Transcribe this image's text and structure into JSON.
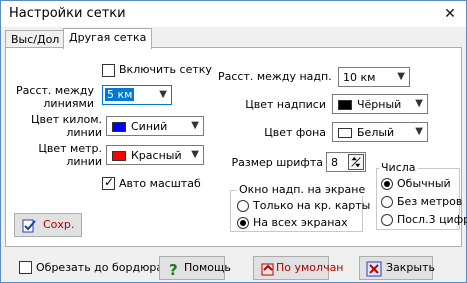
{
  "window": {
    "title": "Настройки сетки",
    "close_glyph": "✕"
  },
  "tabs": [
    {
      "label": "Выс/Дол",
      "active": false
    },
    {
      "label": "Другая сетка",
      "active": true
    }
  ],
  "left": {
    "enable_grid_label": "Включить сетку",
    "enable_grid_checked": false,
    "distance_label": "Расст. между\nлиниями",
    "distance_value": "5 км",
    "km_color_label": "Цвет килом.\nлинии",
    "km_color_value": "Синий",
    "km_color_hex": "#0000ff",
    "m_color_label": "Цвет метр.\nлинии",
    "m_color_value": "Красный",
    "m_color_hex": "#ff0000",
    "auto_scale_label": "Авто масштаб",
    "auto_scale_checked": true,
    "save_button": "Сохр."
  },
  "right": {
    "label_distance_label": "Расст. между надп.",
    "label_distance_value": "10 км",
    "label_color_label": "Цвет надписи",
    "label_color_value": "Чёрный",
    "label_color_hex": "#000000",
    "bg_color_label": "Цвет фона",
    "bg_color_value": "Белый",
    "bg_color_hex": "#ffffff",
    "font_size_label": "Размер шрифта",
    "font_size_value": "8",
    "window_group": {
      "title": "Окно надп. на экране",
      "options": [
        "Только на кр. карты",
        "На всех экранах"
      ],
      "selected": 1
    },
    "numbers_group": {
      "title": "Числа",
      "options": [
        "Обычный",
        "Без метров",
        "Посл.3 цифр"
      ],
      "selected": 0
    }
  },
  "bottom": {
    "crop_label": "Обрезать до бордюра",
    "crop_checked": false,
    "help_button": "Помощь",
    "default_button": "По умолчан",
    "close_button": "Закрыть"
  }
}
